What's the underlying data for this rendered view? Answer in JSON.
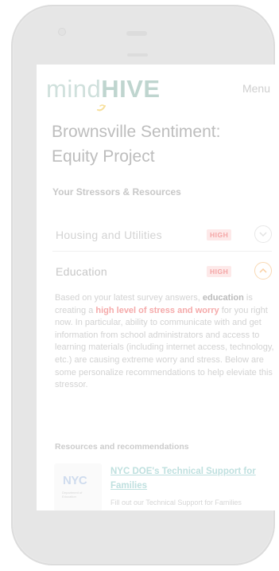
{
  "header": {
    "logo_mind": "mind",
    "logo_hive": "HIVE",
    "menu_label": "Menu"
  },
  "page": {
    "title": "Brownsville Sentiment: Equity Project",
    "section_title": "Your Stressors & Resources"
  },
  "stressors": [
    {
      "label": "Housing and Utilities",
      "badge": "HIGH",
      "expanded": false
    },
    {
      "label": "Education",
      "badge": "HIGH",
      "expanded": true
    }
  ],
  "education_detail": {
    "p1": "Based on your latest survey answers, ",
    "p2": "education",
    "p3": " is creating a ",
    "p4": "high level of stress and worry",
    "p5": " for you right now. In particular, ability to communicate with and get information from school administrators and access to learning materials (including internet access, technology, etc.) are causing extreme worry and stress. Below are some personalize recommendations to help eleviate this stressor."
  },
  "resources": {
    "title": "Resources and recommendations",
    "items": [
      {
        "logo_text": "NYC",
        "logo_sub": "Department of Education",
        "link": "NYC DOE's Technical Support for Families",
        "description": "Fill out our Technical Support for Families"
      }
    ]
  },
  "colors": {
    "badge_text": "#f4a5a5",
    "badge_bg": "#fde9e9",
    "highlight": "#f5aaaa",
    "link": "#bfe0df",
    "toggle_active": "#f9d9b4"
  },
  "icons": {
    "housing_toggle": "chevron-down-icon",
    "education_toggle": "chevron-up-icon",
    "logo_mark": "bee-icon"
  }
}
